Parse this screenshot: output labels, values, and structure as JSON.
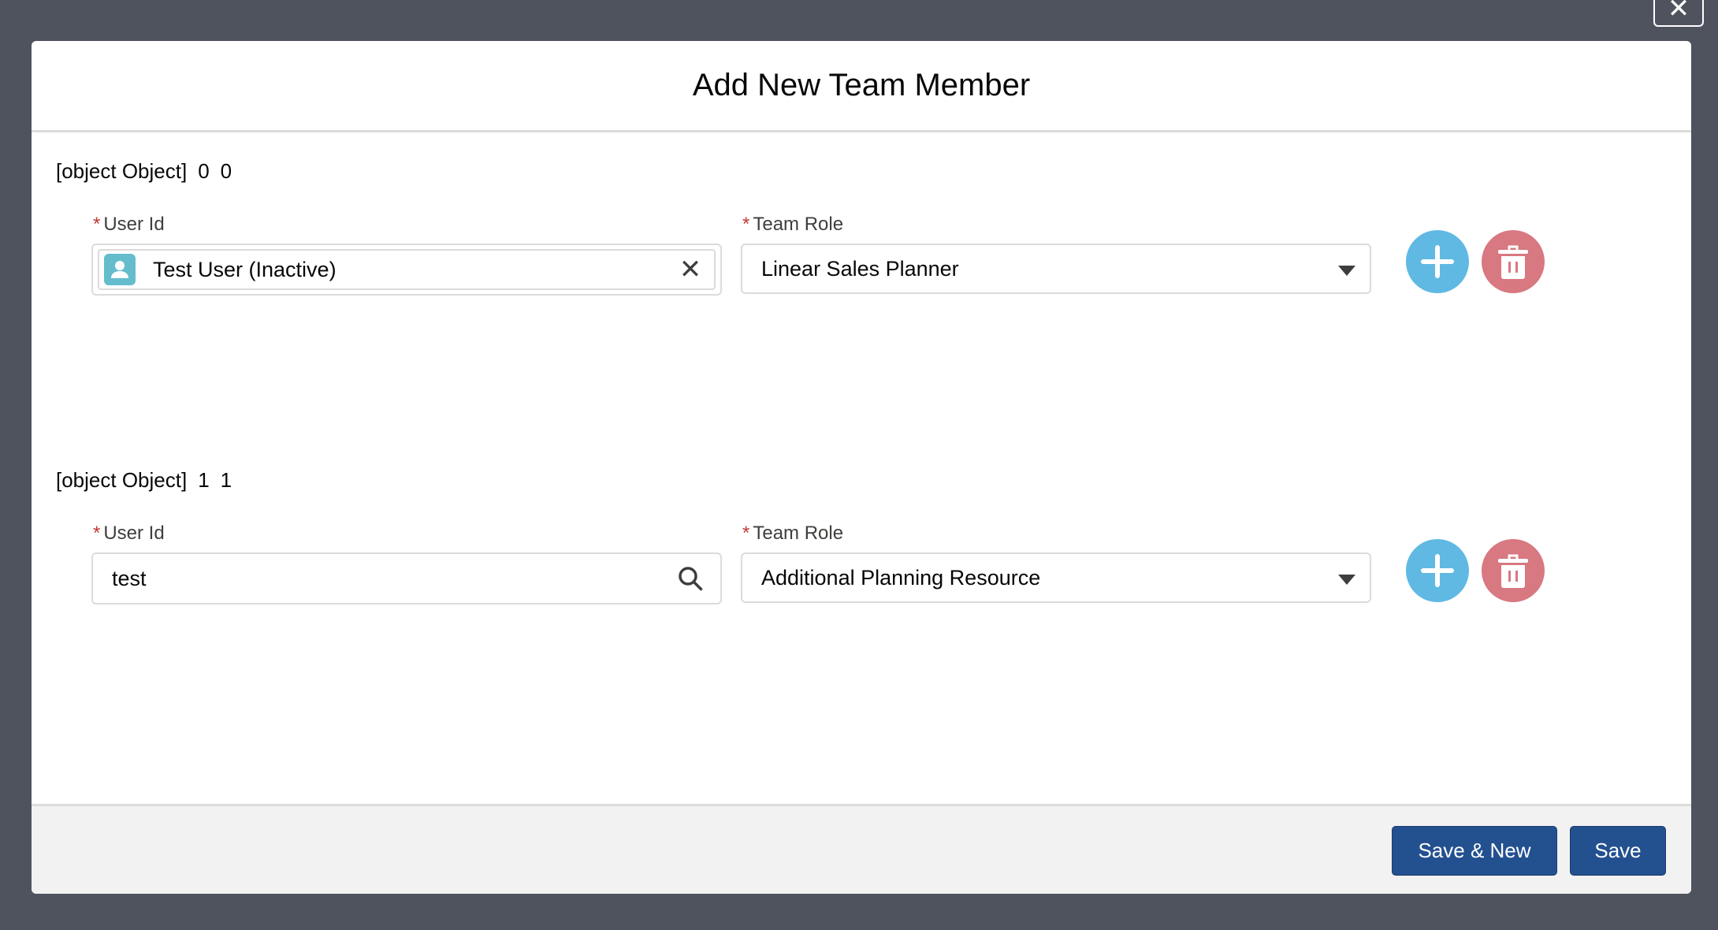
{
  "modal": {
    "title": "Add New Team Member",
    "close_icon": "close-icon"
  },
  "rows": [
    {
      "heading": [
        "[object Object]",
        "0",
        "0"
      ],
      "user_label": "User Id",
      "user_value": "Test User (Inactive)",
      "role_label": "Team Role",
      "role_value": "Linear Sales Planner"
    },
    {
      "heading": [
        "[object Object]",
        "1",
        "1"
      ],
      "user_label": "User Id",
      "user_value": "test",
      "role_label": "Team Role",
      "role_value": "Additional Planning Resource"
    }
  ],
  "required_mark": "*",
  "footer": {
    "save_new": "Save & New",
    "save": "Save"
  },
  "colors": {
    "add": "#5fb9e3",
    "delete": "#d87880",
    "primary": "#23508f",
    "required": "#c23934"
  }
}
